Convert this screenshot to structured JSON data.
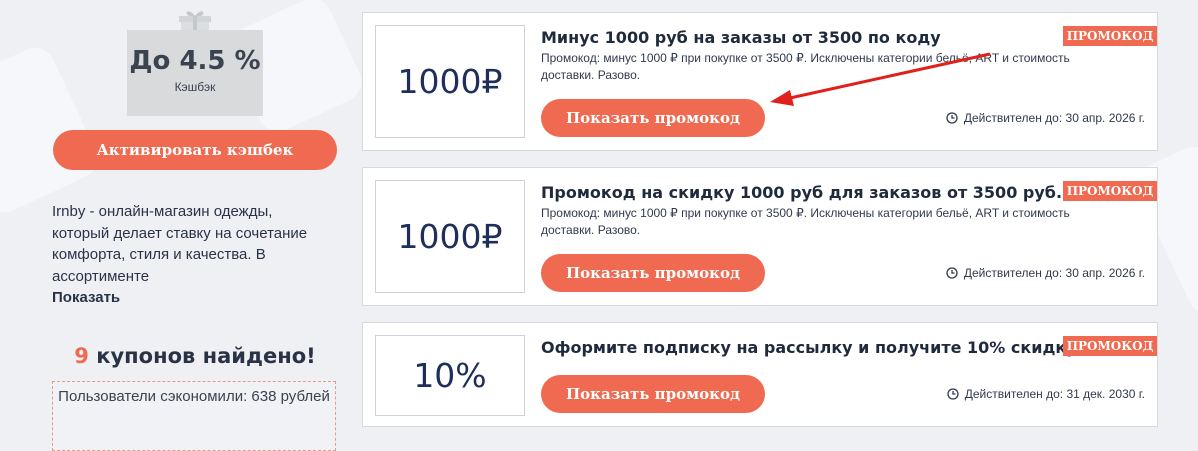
{
  "sidebar": {
    "cashback_value": "До 4.5 %",
    "cashback_label": "Кэшбэк",
    "activate_label": "Активировать кэшбек",
    "description": "Irnby - онлайн-магазин одежды, который делает ставку на сочетание комфорта, стиля и качества. В ассортименте",
    "show_more": "Показать",
    "coupons_count": "9",
    "coupons_found_text": " купонов найдено!",
    "savings_text": "Пользователи сэкономили: 638 рублей"
  },
  "coupons": [
    {
      "value": "1000₽",
      "title": "Минус 1000 руб на заказы от 3500 по коду",
      "description": "Промокод: минус 1000 ₽ при покупке от 3500 ₽. Исключены категории бельё, ART и стоимость доставки. Разово.",
      "badge": "ПРОМОКОД",
      "button_label": "Показать промокод",
      "valid_until": "Действителен до: 30 апр. 2026 г."
    },
    {
      "value": "1000₽",
      "title": "Промокод на скидку 1000 руб для заказов от 3500 руб.",
      "description": "Промокод: минус 1000 ₽ при покупке от 3500 ₽. Исключены категории бельё, ART и стоимость доставки. Разово.",
      "badge": "ПРОМОКОД",
      "button_label": "Показать промокод",
      "valid_until": "Действителен до: 30 апр. 2026 г."
    },
    {
      "value": "10%",
      "title": "Оформите подписку на рассылку и получите 10% скидку",
      "description": "",
      "badge": "ПРОМОКОД",
      "button_label": "Показать промокод",
      "valid_until": "Действителен до: 31 дек. 2030 г."
    }
  ],
  "colors": {
    "accent": "#ef6a50",
    "annotation_arrow": "#e0201b",
    "background": "#eef0f4"
  },
  "icons": {
    "gift": "gift-icon",
    "clock": "clock-icon",
    "arrow": "red-arrow-annotation"
  }
}
